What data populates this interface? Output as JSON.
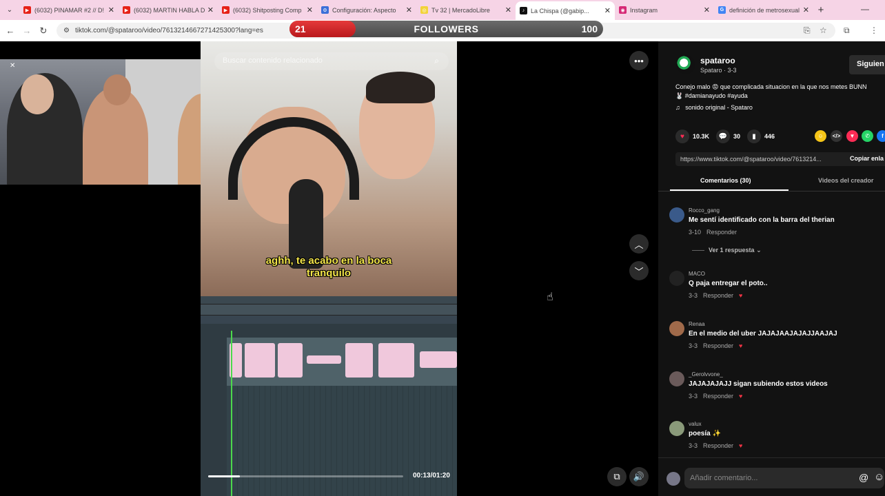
{
  "browser": {
    "tabs": [
      {
        "title": "(6032) PINAMAR #2 // D!",
        "fav_color": "#e62117",
        "fav": "▶"
      },
      {
        "title": "(6032) MARTIN HABLA D!",
        "fav_color": "#e62117",
        "fav": "▶"
      },
      {
        "title": "(6032) Shitposting Comp",
        "fav_color": "#e62117",
        "fav": "▶"
      },
      {
        "title": "Configuración: Aspecto",
        "fav_color": "#3b6fd8",
        "fav": "⚙"
      },
      {
        "title": "Tv 32 | MercadoLibre",
        "fav_color": "#f2d33a",
        "fav": "◎"
      },
      {
        "title": "La Chispa (@gabip...",
        "fav_color": "#111111",
        "fav": "♪"
      },
      {
        "title": "Instagram",
        "fav_color": "#d62976",
        "fav": "◉"
      },
      {
        "title": "definición de metrosexual",
        "fav_color": "#4285f4",
        "fav": "G"
      }
    ],
    "url": "tiktok.com/@spataroo/video/7613214667271425300?lang=es"
  },
  "followers_bar": {
    "current": "21",
    "label": "FOLLOWERS",
    "goal": "100",
    "progress_fraction": 0.21
  },
  "video": {
    "search_placeholder": "Buscar contenido relacionado",
    "subtitle_line1": "aghh, te acabo en la boca",
    "subtitle_line2": "tranquilo",
    "time": "00:13/01:20",
    "progress_fraction": 0.1625
  },
  "panel": {
    "username": "spataroo",
    "subname": "Spataro · 3-3",
    "follow_label": "Siguien",
    "description_line1": "Conejo malo 😡 que complicada situacion en la que nos metes BUNN",
    "description_line2": "🐰 #damianayudo #ayuda",
    "music": "sonido original - Spataro",
    "likes": "10.3K",
    "comments_count": "30",
    "saves": "446",
    "link": "https://www.tiktok.com/@spataroo/video/7613214...",
    "copy_link": "Copiar enla",
    "tab_comments": "Comentarios (30)",
    "tab_creator": "Videos del creador",
    "comments": [
      {
        "user": "Rocco_gang",
        "text": "Me sentí identificado con la barra del therian",
        "date": "3-10",
        "reply": "Responder",
        "avatar_color": "#3a5a8a"
      },
      {
        "user": "MACO",
        "text": "Q paja entregar el poto..",
        "date": "3-3",
        "reply": "Responder",
        "avatar_color": "#222222"
      },
      {
        "user": "Renaa",
        "text": "En el medio del uber JAJAJAAJAJAJJAAJAJ",
        "date": "3-3",
        "reply": "Responder",
        "avatar_color": "#a06a4a"
      },
      {
        "user": "_Gerolvvone_",
        "text": "JAJAJAJAJJ sigan subiendo estos videos",
        "date": "3-3",
        "reply": "Responder",
        "avatar_color": "#6a5a5a"
      },
      {
        "user": "valux",
        "text": "poesía ✨",
        "date": "3-3",
        "reply": "Responder",
        "avatar_color": "#8a9a7a"
      }
    ],
    "view_replies": "Ver 1 respuesta",
    "add_comment_placeholder": "Añadir comentario..."
  }
}
